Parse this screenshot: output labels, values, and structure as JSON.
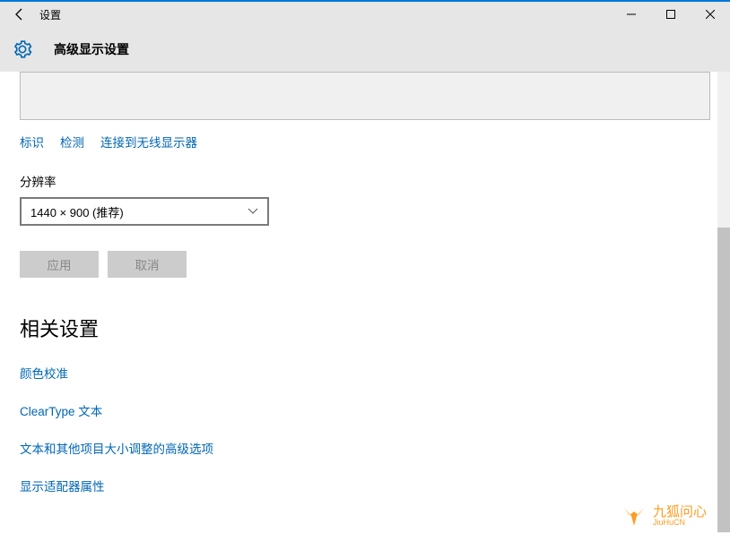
{
  "window": {
    "app_title": "设置",
    "page_title": "高级显示设置"
  },
  "display": {
    "links": {
      "identify": "标识",
      "detect": "检测",
      "connect_wireless": "连接到无线显示器"
    },
    "resolution_label": "分辨率",
    "resolution_value": "1440 × 900 (推荐)",
    "buttons": {
      "apply": "应用",
      "cancel": "取消"
    }
  },
  "related": {
    "heading": "相关设置",
    "links": {
      "color_calibration": "颜色校准",
      "cleartype": "ClearType 文本",
      "advanced_sizing": "文本和其他项目大小调整的高级选项",
      "adapter_properties": "显示适配器属性"
    }
  },
  "watermark": {
    "cn": "九狐问心",
    "en": "JiuHuCN"
  }
}
